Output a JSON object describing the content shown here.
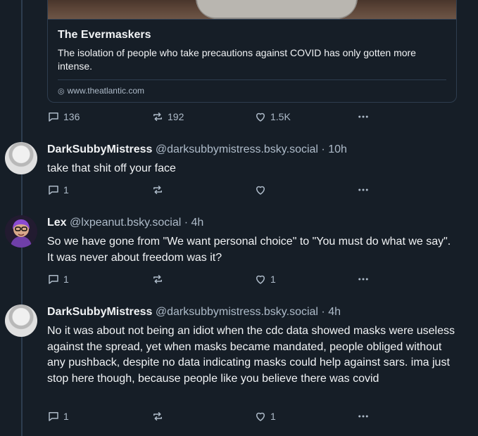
{
  "card": {
    "title": "The Evermaskers",
    "description": "The isolation of people who take precautions against COVID has only gotten more intense.",
    "url": "www.theatlantic.com"
  },
  "main_actions": {
    "replies": "136",
    "reposts": "192",
    "likes": "1.5K"
  },
  "replies": [
    {
      "name": "DarkSubbyMistress",
      "handle": "@darksubbymistress.bsky.social",
      "time": "· 10h",
      "text": "take that shit off your face",
      "reply_count": "1",
      "repost_count": "",
      "like_count": ""
    },
    {
      "name": "Lex",
      "handle": "@lxpeanut.bsky.social",
      "time": "· 4h",
      "text": "So we have gone from \"We want personal choice\" to \"You must do what we say\". It was never about freedom was it?",
      "reply_count": "1",
      "repost_count": "",
      "like_count": "1"
    },
    {
      "name": "DarkSubbyMistress",
      "handle": "@darksubbymistress.bsky.social",
      "time": "· 4h",
      "text": "No it was about not being an idiot when the cdc data showed masks were useless against the spread, yet when masks became mandated, people obliged without any pushback, despite no data indicating masks could help against sars. ima just stop here though, because people like you believe there was covid",
      "reply_count": "1",
      "repost_count": "",
      "like_count": "1"
    }
  ],
  "icons": {
    "reply": "reply-bubble-icon",
    "repost": "repost-icon",
    "like": "heart-icon",
    "more": "more-icon",
    "link": "globe-icon"
  }
}
